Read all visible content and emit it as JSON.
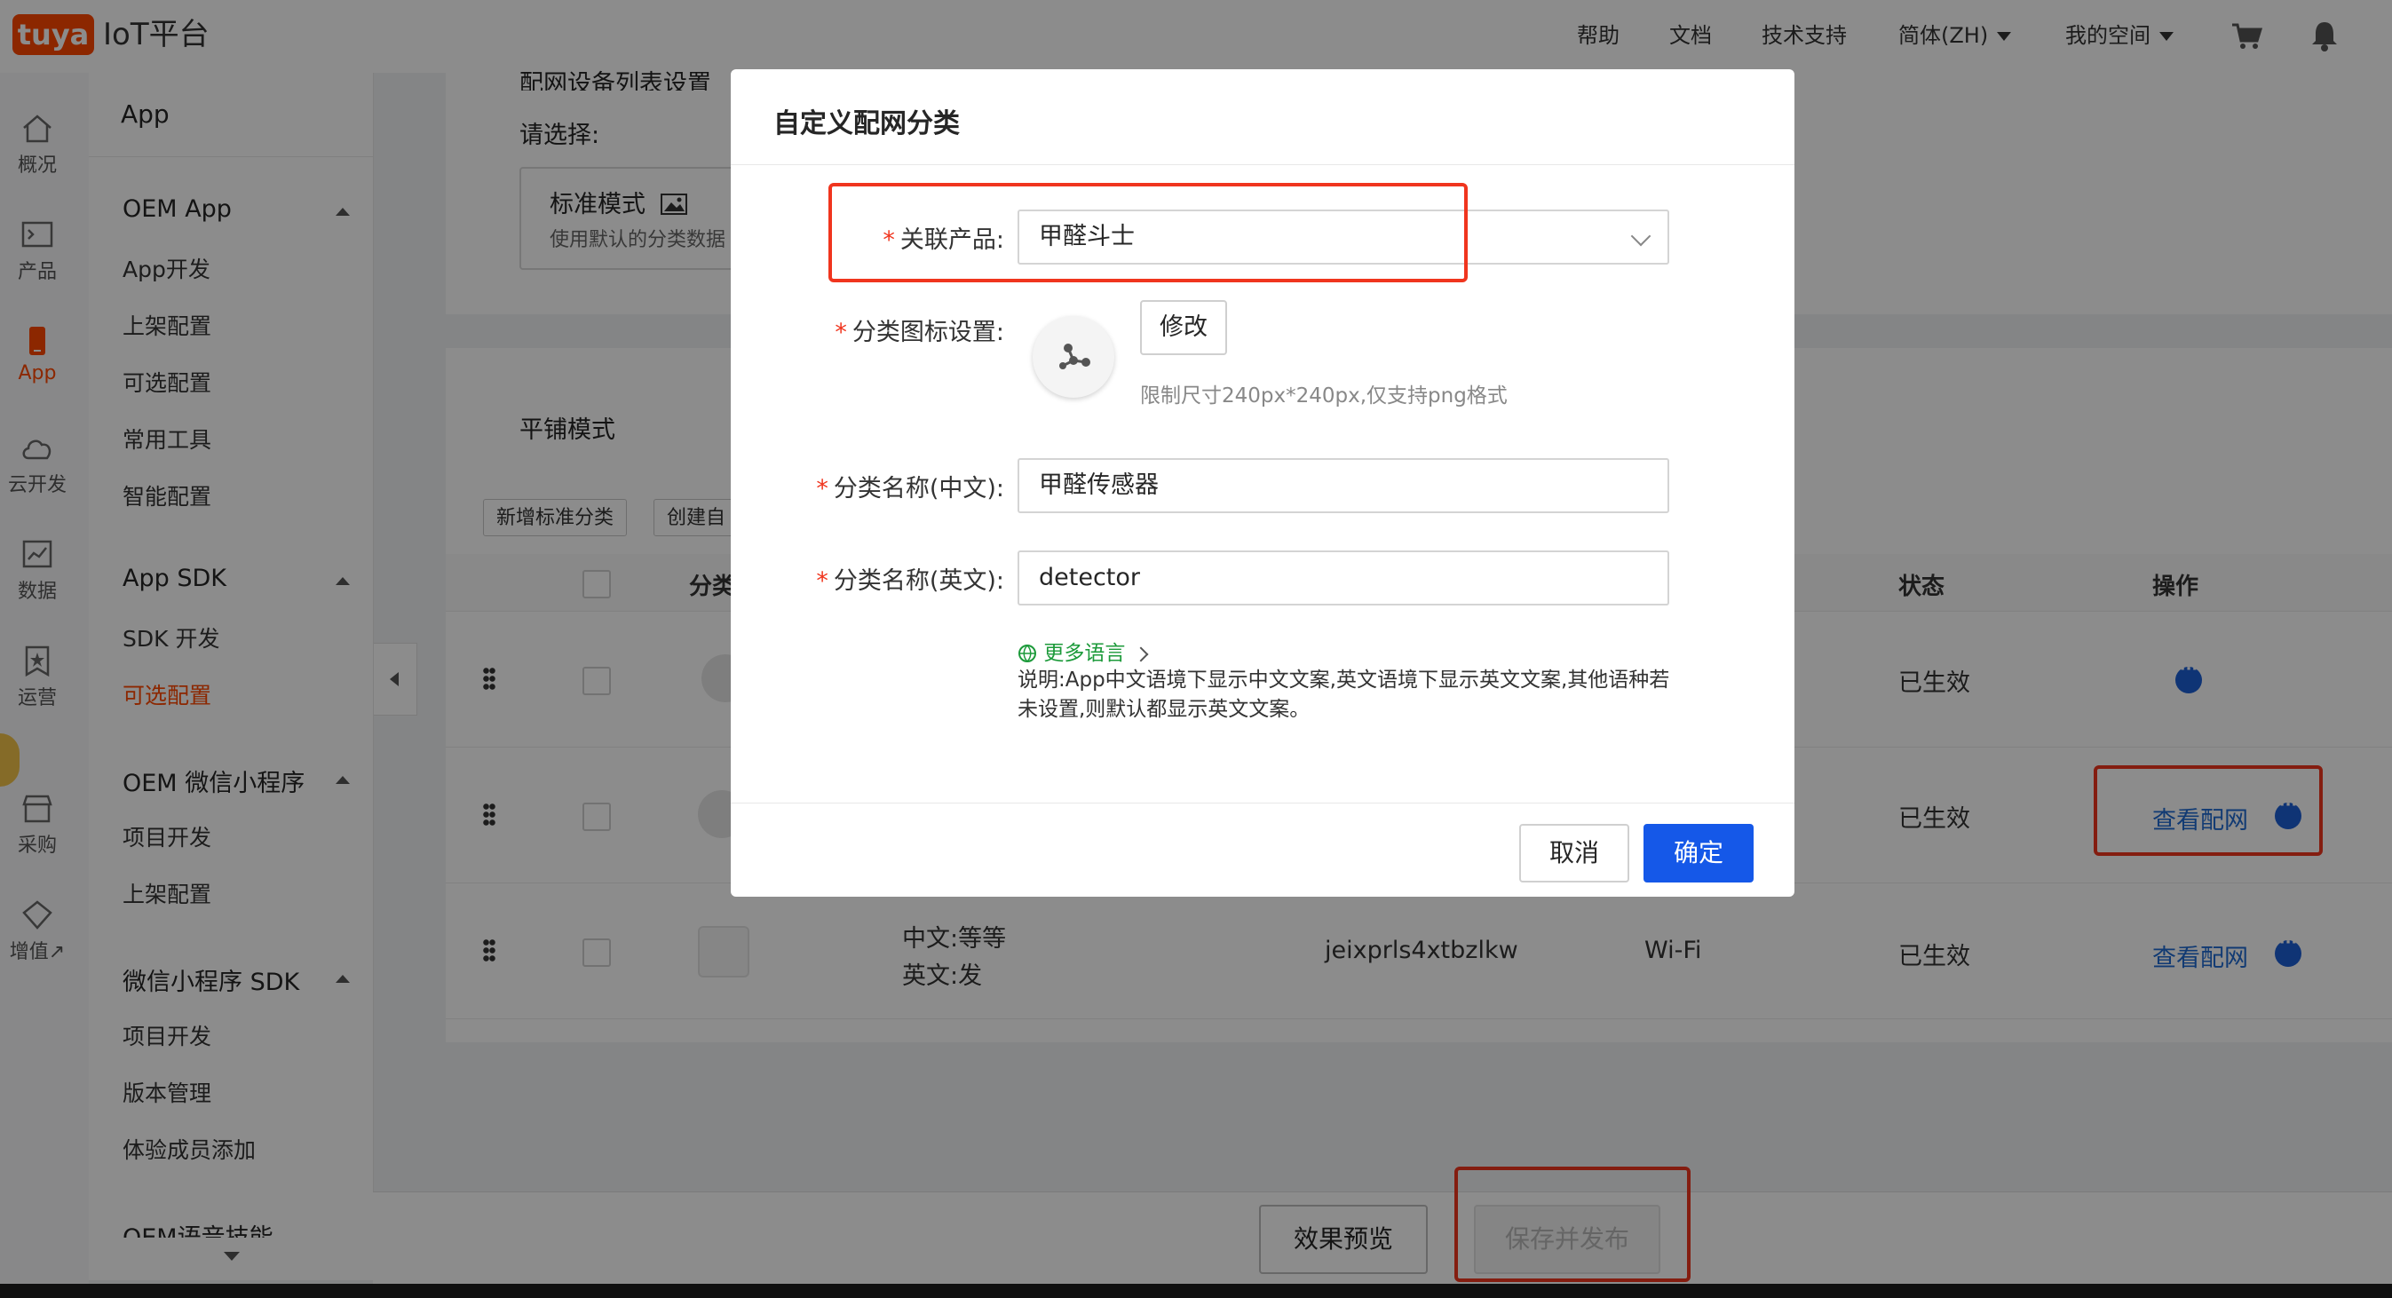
{
  "topbar": {
    "logo": "tuya",
    "brand": "IoT平台",
    "nav": [
      "帮助",
      "文档",
      "技术支持"
    ],
    "lang": "简体(ZH)",
    "space": "我的空间",
    "icons": [
      "cart-icon",
      "bell-icon"
    ]
  },
  "rail": {
    "items": [
      {
        "label": "概况",
        "icon": "home-icon"
      },
      {
        "label": "产品",
        "icon": "terminal-icon"
      },
      {
        "label": "App",
        "icon": "phone-icon",
        "active": true
      },
      {
        "label": "云开发",
        "icon": "cloud-icon"
      },
      {
        "label": "数据",
        "icon": "chart-icon"
      },
      {
        "label": "运营",
        "icon": "star-badge-icon"
      },
      {
        "label": "采购",
        "icon": "store-icon"
      },
      {
        "label": "增值",
        "icon": "diamond-icon",
        "suffix": "↗"
      }
    ]
  },
  "subnav": {
    "title": "App",
    "groups": [
      {
        "label": "OEM App",
        "items": [
          "App开发",
          "上架配置",
          "可选配置",
          "常用工具",
          "智能配置"
        ]
      },
      {
        "label": "App SDK",
        "items": [
          "SDK 开发",
          "可选配置"
        ]
      },
      {
        "label": "OEM 微信小程序",
        "items": [
          "项目开发",
          "上架配置"
        ]
      },
      {
        "label": "微信小程序 SDK",
        "items": [
          "项目开发",
          "版本管理",
          "体验成员添加"
        ]
      },
      {
        "label": "OEM语音技能",
        "items": []
      }
    ],
    "active_item": "可选配置"
  },
  "main": {
    "section_title": "配网设备列表设置",
    "select_label": "请选择:",
    "mode": {
      "title": "标准模式",
      "desc": "使用默认的分类数据"
    },
    "tile_title": "平铺模式",
    "buttons": [
      "新增标准分类",
      "创建自"
    ],
    "table": {
      "headers": {
        "category": "分类",
        "status": "状态",
        "action": "操作"
      },
      "rows": [
        {
          "status": "已生效",
          "action": ""
        },
        {
          "status": "已生效",
          "action": "查看配网"
        },
        {
          "name_cn": "中文:等等",
          "name_en": "英文:发",
          "pid": "jeixprls4xtbzlkw",
          "protocol": "Wi-Fi",
          "status": "已生效",
          "action": "查看配网"
        }
      ]
    },
    "footer": {
      "preview": "效果预览",
      "publish": "保存并发布"
    }
  },
  "modal": {
    "title": "自定义配网分类",
    "product_label": "关联产品:",
    "product_value": "甲醛斗士",
    "icon_label": "分类图标设置:",
    "edit_button": "修改",
    "icon_hint": "限制尺寸240px*240px,仅支持png格式",
    "name_cn_label": "分类名称(中文):",
    "name_cn_value": "甲醛传感器",
    "name_en_label": "分类名称(英文):",
    "name_en_value": "detector",
    "more_lang": "更多语言",
    "note": "说明:App中文语境下显示中文文案,英文语境下显示英文文案,其他语种若未设置,则默认都显示英文文案。",
    "cancel": "取消",
    "ok": "确定"
  },
  "colors": {
    "brand": "#ff4800",
    "primary": "#1558e8",
    "link": "#1f6bd1",
    "highlight": "#f0351e",
    "green_link": "#1c9a3a"
  }
}
